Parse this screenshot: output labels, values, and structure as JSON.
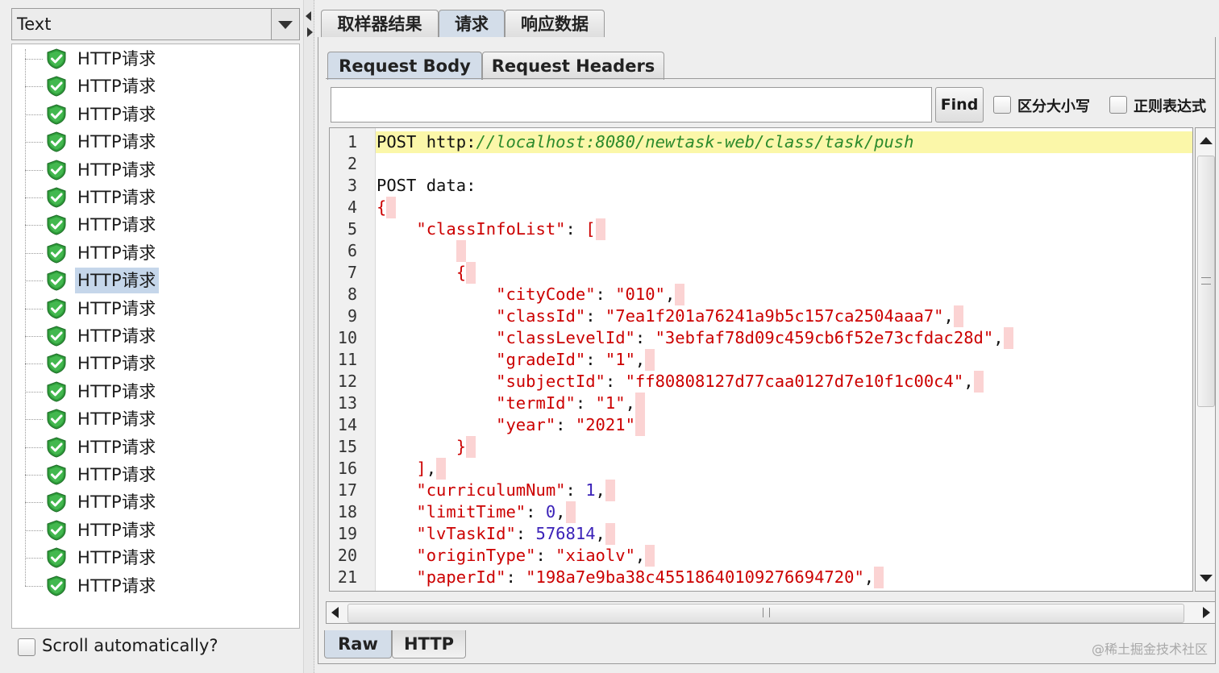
{
  "left": {
    "view_select": "Text",
    "tree_items": [
      "HTTP请求",
      "HTTP请求",
      "HTTP请求",
      "HTTP请求",
      "HTTP请求",
      "HTTP请求",
      "HTTP请求",
      "HTTP请求",
      "HTTP请求",
      "HTTP请求",
      "HTTP请求",
      "HTTP请求",
      "HTTP请求",
      "HTTP请求",
      "HTTP请求",
      "HTTP请求",
      "HTTP请求",
      "HTTP请求",
      "HTTP请求",
      "HTTP请求"
    ],
    "selected_index": 8,
    "scroll_auto_label": "Scroll automatically?"
  },
  "tabs": {
    "sampler_result": "取样器结果",
    "request": "请求",
    "response_data": "响应数据"
  },
  "subtabs": {
    "request_body": "Request Body",
    "request_headers": "Request Headers"
  },
  "search": {
    "value": "",
    "find_label": "Find",
    "case_label": "区分大小写",
    "regex_label": "正则表达式"
  },
  "editor": {
    "line_numbers": [
      "1",
      "2",
      "3",
      "4",
      "5",
      "6",
      "7",
      "8",
      "9",
      "10",
      "11",
      "12",
      "13",
      "14",
      "15",
      "16",
      "17",
      "18",
      "19",
      "20",
      "21"
    ],
    "method": "POST",
    "url_scheme": "http:",
    "url_rest": "//localhost:8080/newtask-web/class/task/push",
    "post_data_label": "POST data:",
    "fields": {
      "classInfoList": "\"classInfoList\"",
      "cityCode_k": "\"cityCode\"",
      "cityCode_v": "\"010\"",
      "classId_k": "\"classId\"",
      "classId_v": "\"7ea1f201a76241a9b5c157ca2504aaa7\"",
      "classLevelId_k": "\"classLevelId\"",
      "classLevelId_v": "\"3ebfaf78d09c459cb6f52e73cfdac28d\"",
      "gradeId_k": "\"gradeId\"",
      "gradeId_v": "\"1\"",
      "subjectId_k": "\"subjectId\"",
      "subjectId_v": "\"ff80808127d77caa0127d7e10f1c00c4\"",
      "termId_k": "\"termId\"",
      "termId_v": "\"1\"",
      "year_k": "\"year\"",
      "year_v": "\"2021\"",
      "curriculumNum_k": "\"curriculumNum\"",
      "curriculumNum_v": "1",
      "limitTime_k": "\"limitTime\"",
      "limitTime_v": "0",
      "lvTaskId_k": "\"lvTaskId\"",
      "lvTaskId_v": "576814",
      "originType_k": "\"originType\"",
      "originType_v": "\"xiaolv\"",
      "paperId_k": "\"paperId\"",
      "paperId_v": "\"198a7e9ba38c45518640109276694720\""
    }
  },
  "bottom_tabs": {
    "raw": "Raw",
    "http": "HTTP"
  },
  "watermark": "@稀土掘金技术社区",
  "colors": {
    "selected_bg": "#c5d6ea",
    "active_tab": "#d3dde9",
    "line_highlight": "#fbf7a9",
    "json_red": "#cc0000",
    "json_number": "#3b22b8",
    "url_green": "#2c8a2c"
  }
}
